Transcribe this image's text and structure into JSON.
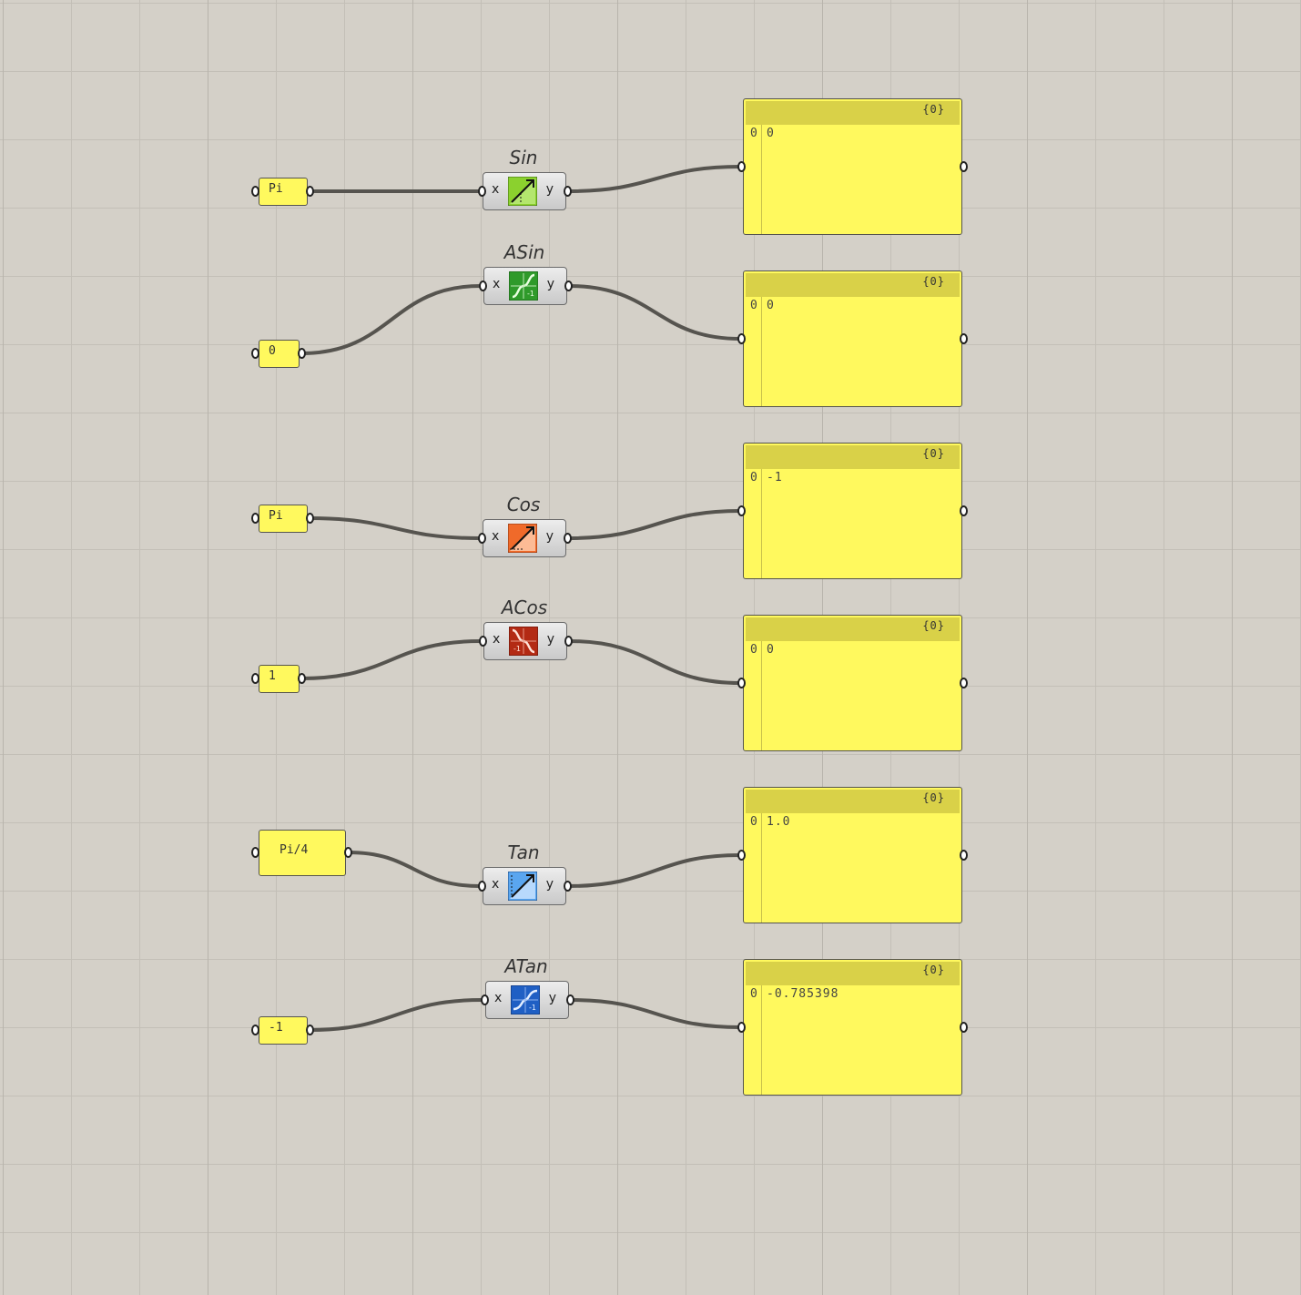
{
  "canvas": {
    "background": "#d4d0c8",
    "grid": "on",
    "panel_color": "#fff95e",
    "panel_header_color": "#d9d148",
    "wire_color": "#56544f"
  },
  "rows": [
    {
      "input": "Pi",
      "component": {
        "nickname": "Sin",
        "input_param": "x",
        "output_param": "y",
        "icon": "sine-function-icon"
      },
      "output": {
        "path": "{0}",
        "index": "0",
        "value": "0"
      }
    },
    {
      "input": "0",
      "component": {
        "nickname": "ASin",
        "input_param": "x",
        "output_param": "y",
        "icon": "arcsine-function-icon"
      },
      "output": {
        "path": "{0}",
        "index": "0",
        "value": "0"
      }
    },
    {
      "input": "Pi",
      "component": {
        "nickname": "Cos",
        "input_param": "x",
        "output_param": "y",
        "icon": "cosine-function-icon"
      },
      "output": {
        "path": "{0}",
        "index": "0",
        "value": "-1"
      }
    },
    {
      "input": "1",
      "component": {
        "nickname": "ACos",
        "input_param": "x",
        "output_param": "y",
        "icon": "arccosine-function-icon"
      },
      "output": {
        "path": "{0}",
        "index": "0",
        "value": "0"
      }
    },
    {
      "input": "Pi/4",
      "component": {
        "nickname": "Tan",
        "input_param": "x",
        "output_param": "y",
        "icon": "tangent-function-icon"
      },
      "output": {
        "path": "{0}",
        "index": "0",
        "value": "1.0"
      }
    },
    {
      "input": "-1",
      "component": {
        "nickname": "ATan",
        "input_param": "x",
        "output_param": "y",
        "icon": "arctangent-function-icon"
      },
      "output": {
        "path": "{0}",
        "index": "0",
        "value": "-0.785398"
      }
    }
  ]
}
